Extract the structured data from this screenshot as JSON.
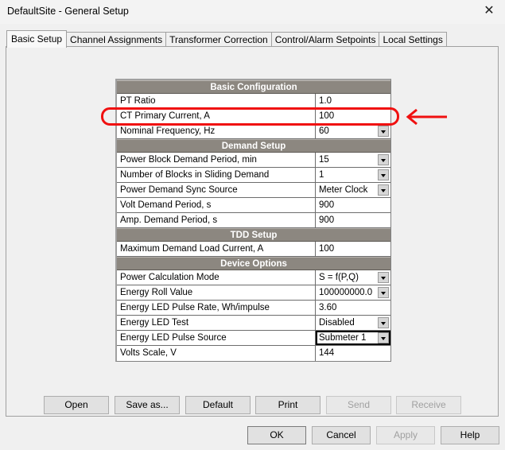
{
  "window": {
    "title": "DefaultSite - General Setup",
    "close_icon": "close-icon"
  },
  "tabs": [
    {
      "label": "Basic Setup",
      "active": true
    },
    {
      "label": "Channel Assignments",
      "active": false
    },
    {
      "label": "Transformer Correction",
      "active": false
    },
    {
      "label": "Control/Alarm Setpoints",
      "active": false
    },
    {
      "label": "Local Settings",
      "active": false
    }
  ],
  "grid": {
    "sections": [
      {
        "title": "Basic Configuration",
        "rows": [
          {
            "label": "PT Ratio",
            "value": "1.0",
            "dropdown": false
          },
          {
            "label": "CT Primary Current, A",
            "value": "100",
            "dropdown": false
          },
          {
            "label": "Nominal Frequency, Hz",
            "value": "60",
            "dropdown": true
          }
        ]
      },
      {
        "title": "Demand Setup",
        "rows": [
          {
            "label": "Power Block Demand Period, min",
            "value": "15",
            "dropdown": true
          },
          {
            "label": "Number of Blocks in Sliding Demand",
            "value": "1",
            "dropdown": true
          },
          {
            "label": "Power Demand Sync Source",
            "value": "Meter Clock",
            "dropdown": true
          },
          {
            "label": "Volt Demand Period, s",
            "value": "900",
            "dropdown": false
          },
          {
            "label": "Amp. Demand Period, s",
            "value": "900",
            "dropdown": false
          }
        ]
      },
      {
        "title": "TDD Setup",
        "rows": [
          {
            "label": "Maximum Demand Load Current, A",
            "value": "100",
            "dropdown": false
          }
        ]
      },
      {
        "title": "Device Options",
        "rows": [
          {
            "label": "Power Calculation Mode",
            "value": "S = f(P,Q)",
            "dropdown": true
          },
          {
            "label": "Energy Roll Value",
            "value": "100000000.0",
            "dropdown": true
          },
          {
            "label": "Energy LED Pulse Rate, Wh/impulse",
            "value": "3.60",
            "dropdown": false
          },
          {
            "label": "Energy LED Test",
            "value": "Disabled",
            "dropdown": true
          },
          {
            "label": "Energy LED Pulse Source",
            "value": "Submeter 1",
            "dropdown": true,
            "focused": true
          },
          {
            "label": "Volts Scale, V",
            "value": "144",
            "dropdown": false
          }
        ]
      }
    ]
  },
  "annotation": {
    "highlighted_row": "CT Primary Current, A",
    "color": "#f01010"
  },
  "panel_buttons": {
    "open": "Open",
    "save_as": "Save as...",
    "default": "Default",
    "print": "Print",
    "send": "Send",
    "receive": "Receive"
  },
  "dialog_buttons": {
    "ok": "OK",
    "cancel": "Cancel",
    "apply": "Apply",
    "help": "Help"
  }
}
